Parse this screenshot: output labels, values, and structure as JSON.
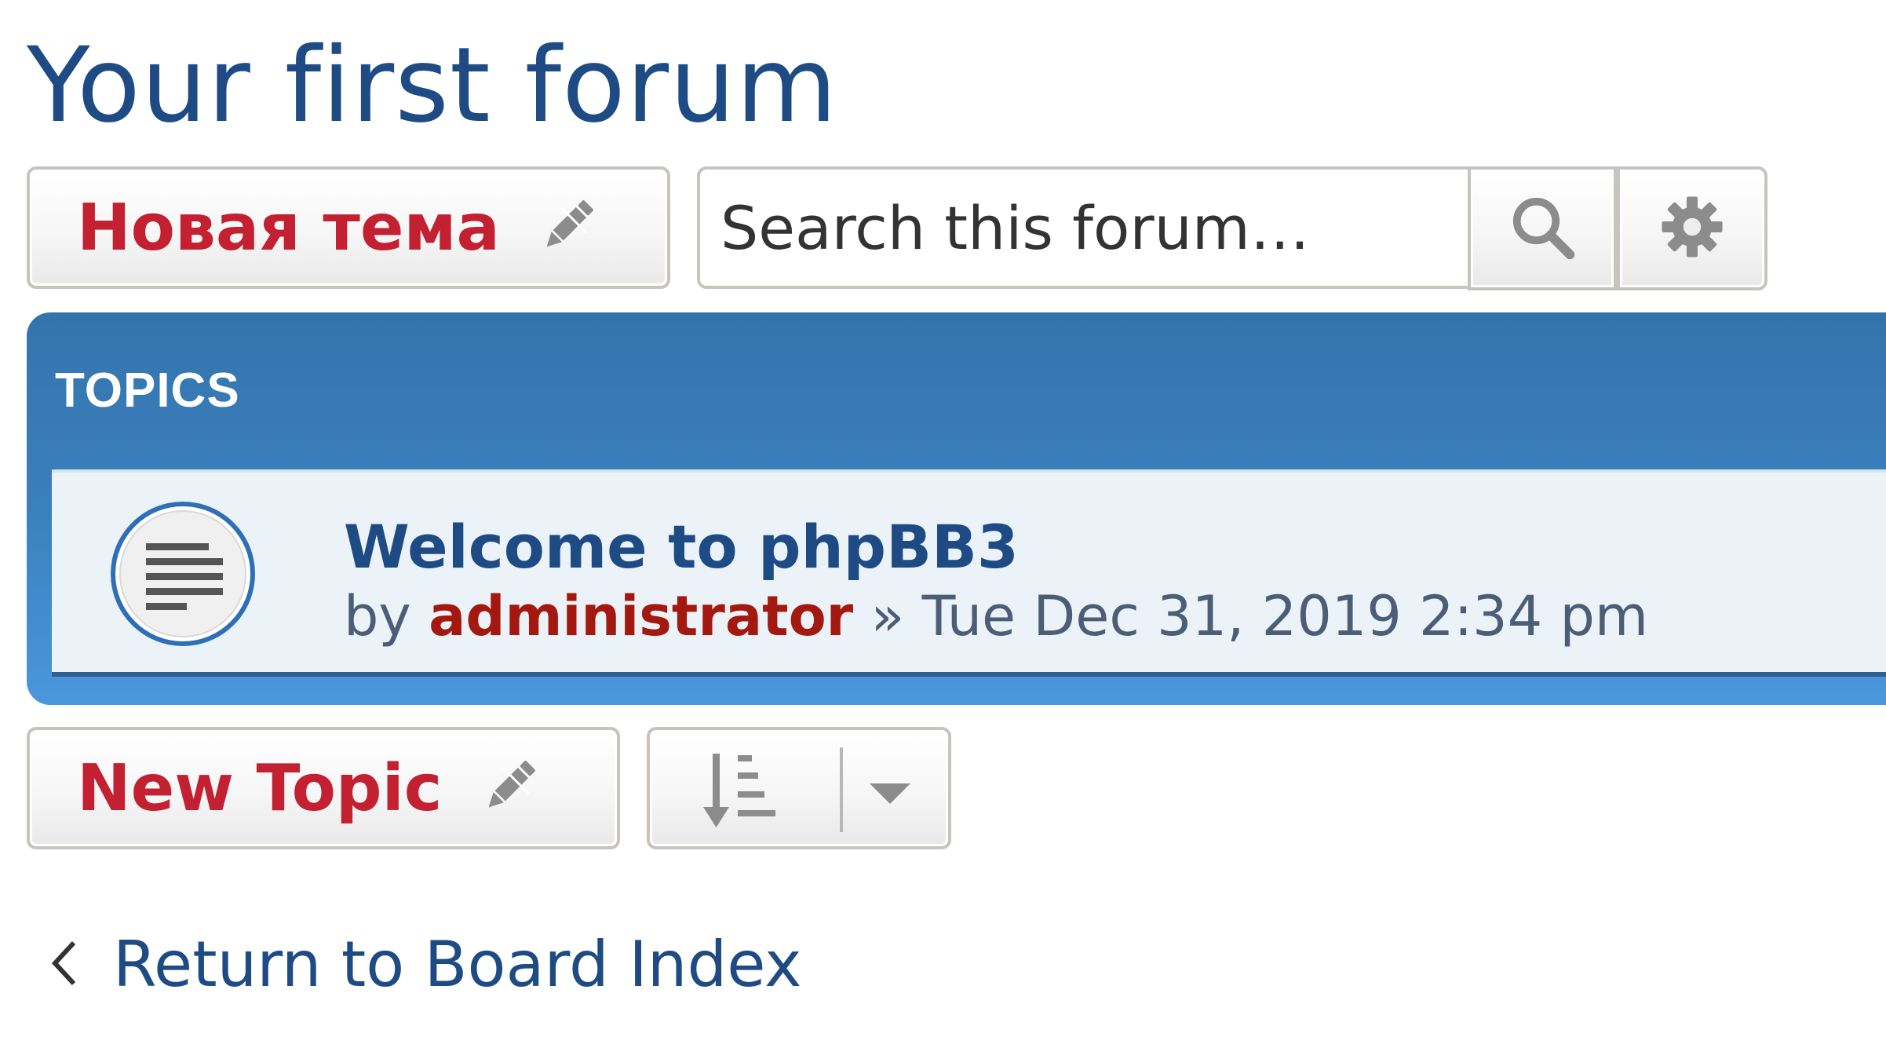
{
  "forum": {
    "title": "Your first forum"
  },
  "actions": {
    "new_topic_top_label": "Новая тема",
    "new_topic_bottom_label": "New Topic"
  },
  "search": {
    "placeholder": "Search this forum…"
  },
  "topics": {
    "header": "TOPICS",
    "items": [
      {
        "title": "Welcome to phpBB3",
        "by_label": "by",
        "author": "administrator",
        "separator": "»",
        "date": "Tue Dec 31, 2019 2:34 pm"
      }
    ]
  },
  "navigation": {
    "return_label": "Return to Board Index"
  },
  "icons": {
    "new_topic": "pencil-icon",
    "search": "search-icon",
    "settings": "gear-icon",
    "topic": "topic-read-icon",
    "sort": "sort-icon",
    "dropdown": "caret-down-icon",
    "back": "chevron-left-icon"
  },
  "colors": {
    "title": "#1f4b85",
    "button_text": "#c32031",
    "panel": "#3a80bd",
    "row_background": "#ecf3f8",
    "author": "#a3180f",
    "meta_text": "#4c5d77"
  }
}
